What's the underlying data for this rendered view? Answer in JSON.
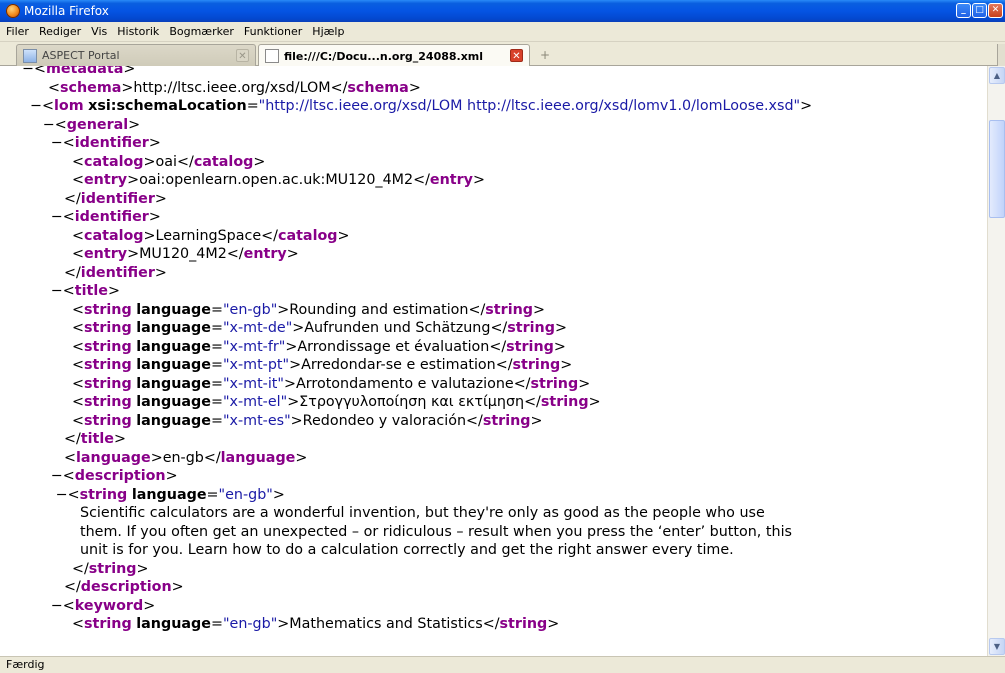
{
  "window": {
    "title": "Mozilla Firefox"
  },
  "menu": [
    "Filer",
    "Rediger",
    "Vis",
    "Historik",
    "Bogmærker",
    "Funktioner",
    "Hjælp"
  ],
  "tabs": [
    {
      "label": "ASPECT Portal",
      "active": false
    },
    {
      "label": "file:///C:/Docu...n.org_24088.xml",
      "active": true
    }
  ],
  "xml_lines": [
    {
      "indent": 1,
      "collapse": true,
      "segs": [
        [
          "t",
          "metadata"
        ]
      ],
      "open": true
    },
    {
      "indent": 2,
      "segs": [
        [
          "o",
          "schema"
        ],
        [
          "x",
          "http://ltsc.ieee.org/xsd/LOM"
        ],
        [
          "c",
          "schema"
        ]
      ]
    },
    {
      "indent": 1.5,
      "collapse": true,
      "open": true,
      "segs": [
        [
          "t",
          "lom"
        ],
        [
          "a",
          "xsi:schemaLocation"
        ],
        [
          "v",
          "\"http://ltsc.ieee.org/xsd/LOM http://ltsc.ieee.org/xsd/lomv1.0/lomLoose.xsd\""
        ]
      ]
    },
    {
      "indent": 2.3,
      "collapse": true,
      "open": true,
      "segs": [
        [
          "t",
          "general"
        ]
      ]
    },
    {
      "indent": 2.8,
      "collapse": true,
      "open": true,
      "segs": [
        [
          "t",
          "identifier"
        ]
      ]
    },
    {
      "indent": 3.5,
      "segs": [
        [
          "o",
          "catalog"
        ],
        [
          "x",
          "oai"
        ],
        [
          "c",
          "catalog"
        ]
      ]
    },
    {
      "indent": 3.5,
      "segs": [
        [
          "o",
          "entry"
        ],
        [
          "x",
          "oai:openlearn.open.ac.uk:MU120_4M2"
        ],
        [
          "c",
          "entry"
        ]
      ]
    },
    {
      "indent": 3.0,
      "segs": [
        [
          "c",
          "identifier"
        ]
      ]
    },
    {
      "indent": 2.8,
      "collapse": true,
      "open": true,
      "segs": [
        [
          "t",
          "identifier"
        ]
      ]
    },
    {
      "indent": 3.5,
      "segs": [
        [
          "o",
          "catalog"
        ],
        [
          "x",
          "LearningSpace"
        ],
        [
          "c",
          "catalog"
        ]
      ]
    },
    {
      "indent": 3.5,
      "segs": [
        [
          "o",
          "entry"
        ],
        [
          "x",
          "MU120_4M2"
        ],
        [
          "c",
          "entry"
        ]
      ]
    },
    {
      "indent": 3.0,
      "segs": [
        [
          "c",
          "identifier"
        ]
      ]
    },
    {
      "indent": 2.8,
      "collapse": true,
      "open": true,
      "segs": [
        [
          "t",
          "title"
        ]
      ]
    },
    {
      "indent": 3.5,
      "segs": [
        [
          "t",
          "string"
        ],
        [
          "a",
          "language"
        ],
        [
          "v",
          "\"en-gb\""
        ],
        [
          "x2",
          "Rounding and estimation"
        ],
        [
          "c",
          "string"
        ]
      ]
    },
    {
      "indent": 3.5,
      "segs": [
        [
          "t",
          "string"
        ],
        [
          "a",
          "language"
        ],
        [
          "v",
          "\"x-mt-de\""
        ],
        [
          "x2",
          "Aufrunden und Schätzung"
        ],
        [
          "c",
          "string"
        ]
      ]
    },
    {
      "indent": 3.5,
      "segs": [
        [
          "t",
          "string"
        ],
        [
          "a",
          "language"
        ],
        [
          "v",
          "\"x-mt-fr\""
        ],
        [
          "x2",
          "Arrondissage et évaluation"
        ],
        [
          "c",
          "string"
        ]
      ]
    },
    {
      "indent": 3.5,
      "segs": [
        [
          "t",
          "string"
        ],
        [
          "a",
          "language"
        ],
        [
          "v",
          "\"x-mt-pt\""
        ],
        [
          "x2",
          "Arredondar-se e estimation"
        ],
        [
          "c",
          "string"
        ]
      ]
    },
    {
      "indent": 3.5,
      "segs": [
        [
          "t",
          "string"
        ],
        [
          "a",
          "language"
        ],
        [
          "v",
          "\"x-mt-it\""
        ],
        [
          "x2",
          "Arrotondamento e valutazione"
        ],
        [
          "c",
          "string"
        ]
      ]
    },
    {
      "indent": 3.5,
      "segs": [
        [
          "t",
          "string"
        ],
        [
          "a",
          "language"
        ],
        [
          "v",
          "\"x-mt-el\""
        ],
        [
          "x2",
          "Στρογγυλοποίηση και εκτίμηση"
        ],
        [
          "c",
          "string"
        ]
      ]
    },
    {
      "indent": 3.5,
      "segs": [
        [
          "t",
          "string"
        ],
        [
          "a",
          "language"
        ],
        [
          "v",
          "\"x-mt-es\""
        ],
        [
          "x2",
          "Redondeo y valoración"
        ],
        [
          "c",
          "string"
        ]
      ]
    },
    {
      "indent": 3.0,
      "segs": [
        [
          "c",
          "title"
        ]
      ]
    },
    {
      "indent": 3.0,
      "segs": [
        [
          "o",
          "language"
        ],
        [
          "x",
          "en-gb"
        ],
        [
          "c",
          "language"
        ]
      ]
    },
    {
      "indent": 2.8,
      "collapse": true,
      "open": true,
      "segs": [
        [
          "t",
          "description"
        ]
      ]
    },
    {
      "indent": 3.1,
      "collapse": true,
      "open": true,
      "segs": [
        [
          "t",
          "string"
        ],
        [
          "a",
          "language"
        ],
        [
          "v",
          "\"en-gb\""
        ],
        [
          "x2",
          ""
        ]
      ]
    },
    {
      "indent": 4.0,
      "segs": [
        [
          "x",
          "Scientific calculators are a wonderful invention, but they're only as good as the people who use"
        ]
      ]
    },
    {
      "indent": 4.0,
      "segs": [
        [
          "x",
          "them. If you often get an unexpected – or ridiculous – result when you press the ‘enter’ button, this"
        ]
      ]
    },
    {
      "indent": 4.0,
      "segs": [
        [
          "x",
          "unit is for you. Learn how to do a calculation correctly and get the right answer every time."
        ]
      ]
    },
    {
      "indent": 3.5,
      "segs": [
        [
          "c",
          "string"
        ]
      ]
    },
    {
      "indent": 3.0,
      "segs": [
        [
          "c",
          "description"
        ]
      ]
    },
    {
      "indent": 2.8,
      "collapse": true,
      "open": true,
      "segs": [
        [
          "t",
          "keyword"
        ]
      ]
    },
    {
      "indent": 3.5,
      "segs": [
        [
          "t",
          "string"
        ],
        [
          "a",
          "language"
        ],
        [
          "v",
          "\"en-gb\""
        ],
        [
          "x2",
          "Mathematics and Statistics"
        ],
        [
          "c",
          "string"
        ]
      ]
    }
  ],
  "status": {
    "text": "Færdig"
  }
}
